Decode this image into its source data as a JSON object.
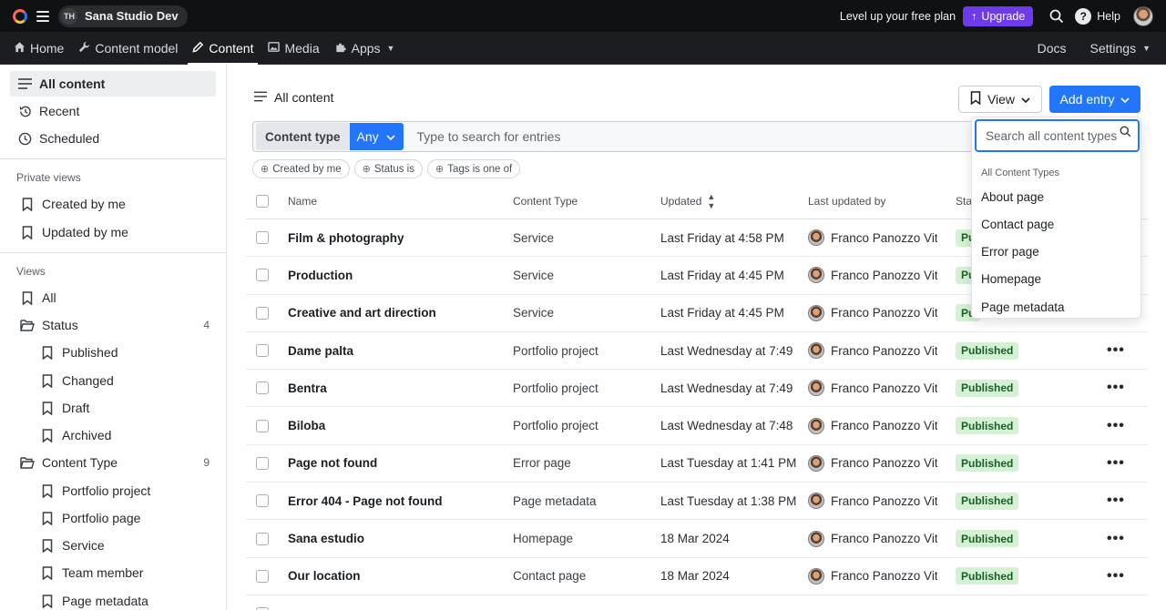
{
  "topbar": {
    "workspace_initials": "TH",
    "workspace_name": "Sana Studio Dev",
    "plan_text": "Level up your free plan",
    "upgrade_label": "Upgrade",
    "help_label": "Help"
  },
  "nav": {
    "items": [
      {
        "label": "Home",
        "icon": "home-icon"
      },
      {
        "label": "Content model",
        "icon": "wrench-icon"
      },
      {
        "label": "Content",
        "icon": "pencil-icon"
      },
      {
        "label": "Media",
        "icon": "image-icon"
      },
      {
        "label": "Apps",
        "icon": "puzzle-icon"
      }
    ],
    "active": "Content",
    "docs_label": "Docs",
    "settings_label": "Settings"
  },
  "sidebar": {
    "top": [
      {
        "label": "All content",
        "icon": "list-icon"
      },
      {
        "label": "Recent",
        "icon": "history-icon"
      },
      {
        "label": "Scheduled",
        "icon": "clock-icon"
      }
    ],
    "private_heading": "Private views",
    "private": [
      "Created by me",
      "Updated by me"
    ],
    "views_heading": "Views",
    "all_label": "All",
    "status_folder": {
      "label": "Status",
      "count": "4"
    },
    "status_items": [
      "Published",
      "Changed",
      "Draft",
      "Archived"
    ],
    "ctype_folder": {
      "label": "Content Type",
      "count": "9"
    },
    "ctype_items": [
      "Portfolio project",
      "Portfolio page",
      "Service",
      "Team member",
      "Page metadata"
    ]
  },
  "main": {
    "title": "All content",
    "view_label": "View",
    "add_label": "Add entry",
    "content_type_label": "Content type",
    "any_label": "Any",
    "search_placeholder": "Type to search for entries",
    "filters": [
      "Created by me",
      "Status is",
      "Tags is one of"
    ]
  },
  "table": {
    "headers": {
      "name": "Name",
      "type": "Content Type",
      "updated": "Updated",
      "by": "Last updated by",
      "status": "Sta"
    },
    "rows": [
      {
        "name": "Film & photography",
        "type": "Service",
        "updated": "Last Friday at 4:58 PM",
        "by": "Franco Panozzo Vitc",
        "status": "Pu"
      },
      {
        "name": "Production",
        "type": "Service",
        "updated": "Last Friday at 4:45 PM",
        "by": "Franco Panozzo Vitc",
        "status": "Pu"
      },
      {
        "name": "Creative and art direction",
        "type": "Service",
        "updated": "Last Friday at 4:45 PM",
        "by": "Franco Panozzo Vitc",
        "status": "Pu"
      },
      {
        "name": "Dame palta",
        "type": "Portfolio project",
        "updated": "Last Wednesday at 7:49",
        "by": "Franco Panozzo Vitc",
        "status": "Published"
      },
      {
        "name": "Bentra",
        "type": "Portfolio project",
        "updated": "Last Wednesday at 7:49",
        "by": "Franco Panozzo Vitc",
        "status": "Published"
      },
      {
        "name": "Biloba",
        "type": "Portfolio project",
        "updated": "Last Wednesday at 7:48",
        "by": "Franco Panozzo Vitc",
        "status": "Published"
      },
      {
        "name": "Page not found",
        "type": "Error page",
        "updated": "Last Tuesday at 1:41 PM",
        "by": "Franco Panozzo Vitc",
        "status": "Published"
      },
      {
        "name": "Error 404 - Page not found",
        "type": "Page metadata",
        "updated": "Last Tuesday at 1:38 PM",
        "by": "Franco Panozzo Vitc",
        "status": "Published"
      },
      {
        "name": "Sana estudio",
        "type": "Homepage",
        "updated": "18 Mar 2024",
        "by": "Franco Panozzo Vitc",
        "status": "Published"
      },
      {
        "name": "Our location",
        "type": "Contact page",
        "updated": "18 Mar 2024",
        "by": "Franco Panozzo Vitc",
        "status": "Published"
      }
    ]
  },
  "dropdown": {
    "search_placeholder": "Search all content types",
    "heading": "All Content Types",
    "items": [
      "About page",
      "Contact page",
      "Error page",
      "Homepage",
      "Page metadata"
    ]
  }
}
